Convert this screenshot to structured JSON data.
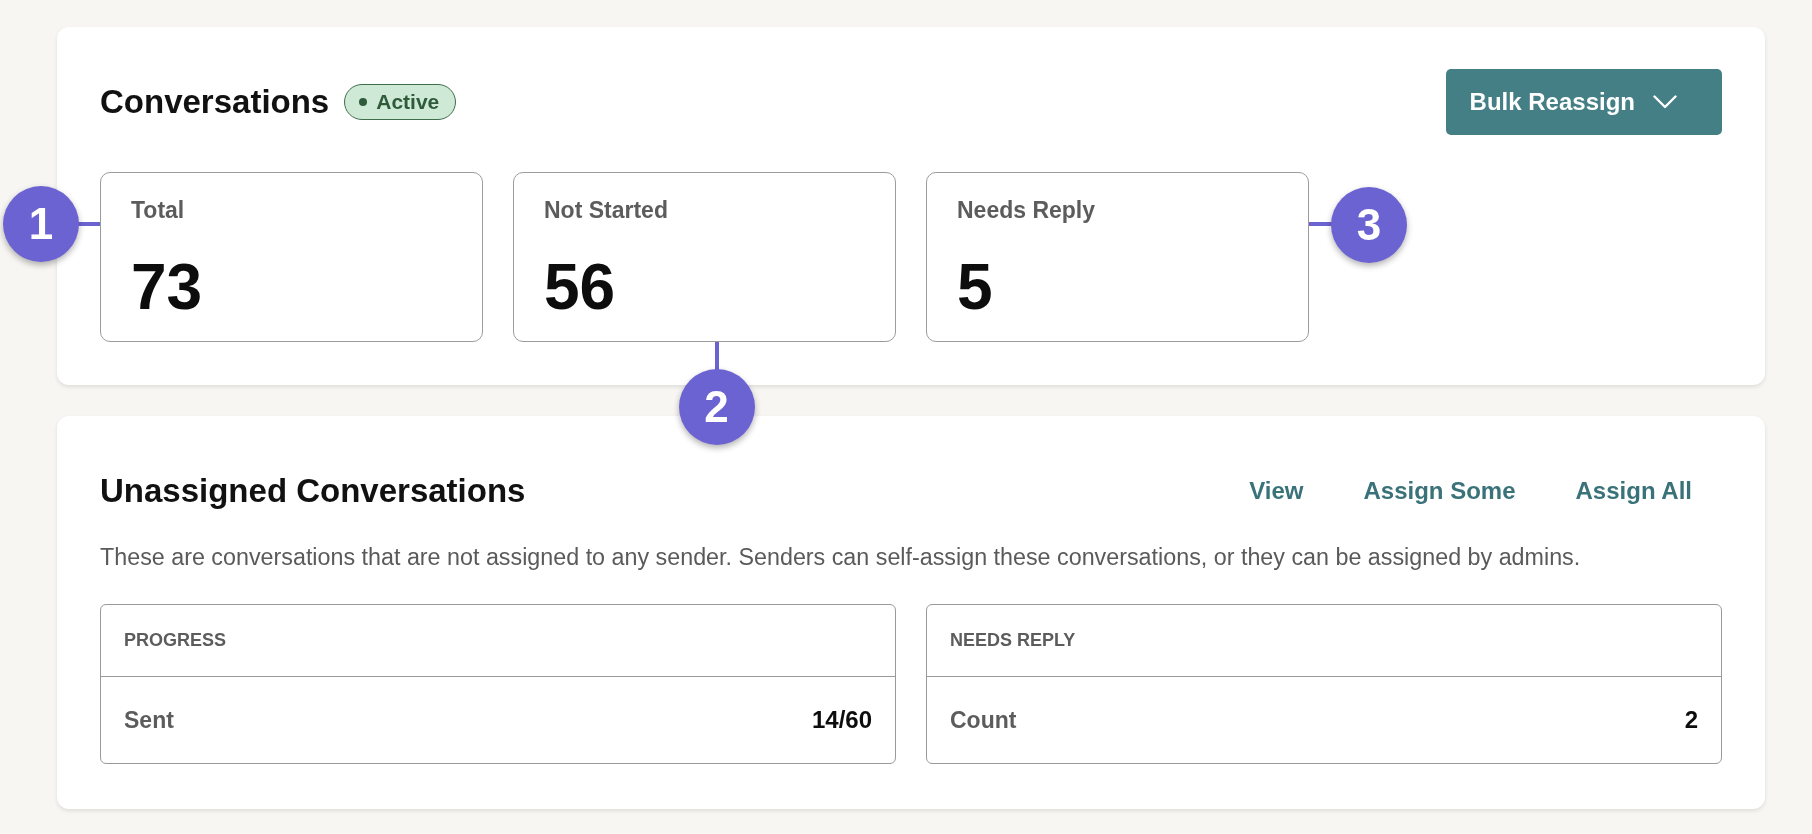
{
  "conversations": {
    "title": "Conversations",
    "status": {
      "label": "Active"
    },
    "bulk_action": {
      "label": "Bulk Reassign"
    },
    "stats": [
      {
        "label": "Total",
        "value": "73",
        "callout": {
          "number": "1",
          "kind": "left"
        }
      },
      {
        "label": "Not Started",
        "value": "56",
        "callout": {
          "number": "2",
          "kind": "bottom"
        }
      },
      {
        "label": "Needs Reply",
        "value": "5",
        "callout": {
          "number": "3",
          "kind": "right"
        }
      }
    ]
  },
  "unassigned": {
    "title": "Unassigned Conversations",
    "actions": [
      "View",
      "Assign Some",
      "Assign All"
    ],
    "description": "These are conversations that are not assigned to any sender. Senders can self-assign these conversations, or they can be assigned by admins.",
    "tables": [
      {
        "heading": "PROGRESS",
        "rows": [
          {
            "label": "Sent",
            "value": "14/60"
          }
        ]
      },
      {
        "heading": "NEEDS REPLY",
        "rows": [
          {
            "label": "Count",
            "value": "2"
          }
        ]
      }
    ]
  }
}
